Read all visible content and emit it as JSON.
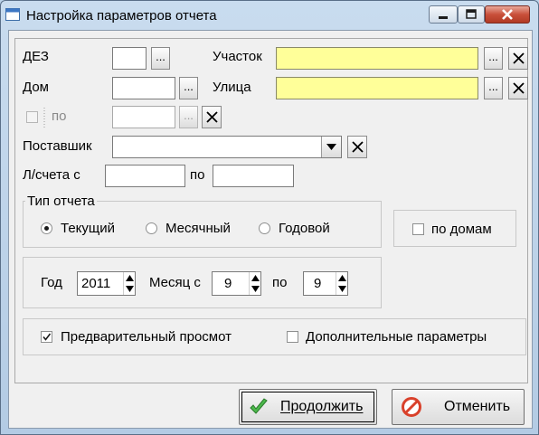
{
  "window": {
    "title": "Настройка параметров отчета",
    "icon": "app-window-icon",
    "controls": [
      "minimize-icon",
      "maximize-icon",
      "close-icon"
    ]
  },
  "filters": {
    "dez_label": "ДЕЗ",
    "dez_value": "",
    "uchastok_label": "Участок",
    "uchastok_value": "",
    "dom_label": "Дом",
    "dom_value": "",
    "ulitsa_label": "Улица",
    "ulitsa_value": "",
    "po_checkbox_label": "по",
    "po_value": "",
    "postavshik_label": "Поставшик",
    "postavshik_value": "",
    "ls_label": "Л/счета с",
    "ls_from": "",
    "ls_po_label": "по",
    "ls_to": "",
    "browse_label": "..."
  },
  "report_type": {
    "caption": "Тип отчета",
    "options": [
      "Текущий",
      "Месячный",
      "Годовой"
    ],
    "selected": "Текущий",
    "by_houses_label": "по домам",
    "by_houses_checked": false
  },
  "period": {
    "year_label": "Год",
    "year": "2011",
    "month_from_label": "Месяц с",
    "month_from": "9",
    "month_to_label": "по",
    "month_to": "9"
  },
  "options": {
    "preview_label": "Предварительный просмот",
    "preview_checked": true,
    "extra_params_label": "Дополнительные параметры",
    "extra_params_checked": false
  },
  "buttons": {
    "continue_label": "Продолжить",
    "cancel_label": "Отменить"
  },
  "colors": {
    "highlight_field": "#ffff99",
    "continue_icon": "#3fa83f",
    "cancel_icon": "#d9412b"
  }
}
